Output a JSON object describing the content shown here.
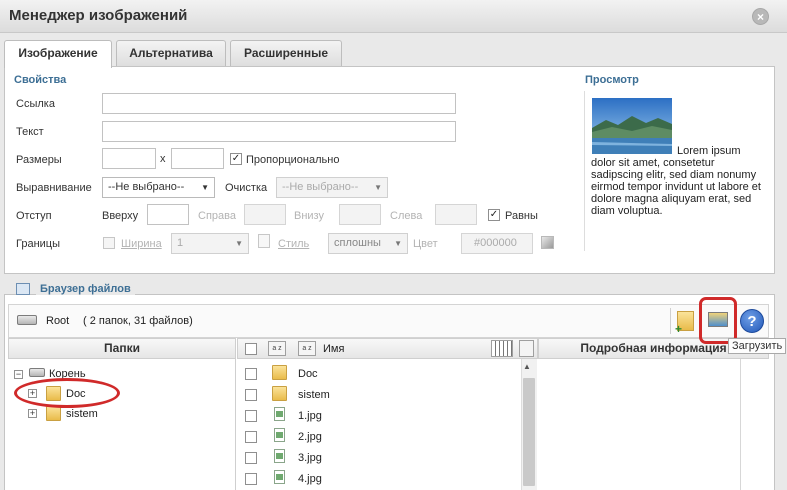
{
  "window": {
    "title": "Менеджер изображений",
    "close_glyph": "×"
  },
  "tabs": [
    {
      "label": "Изображение",
      "active": true
    },
    {
      "label": "Альтернатива",
      "active": false
    },
    {
      "label": "Расширенные",
      "active": false
    }
  ],
  "properties": {
    "section_title": "Свойства",
    "link_label": "Ссылка",
    "text_label": "Текст",
    "dimensions_label": "Размеры",
    "dimensions_separator": "x",
    "proportional_label": "Пропорционально",
    "proportional_checked": true,
    "align_label": "Выравнивание",
    "align_value": "--Не выбрано--",
    "clear_label": "Очистка",
    "clear_value": "--Не выбрано--",
    "margin_label": "Отступ",
    "margin_top_label": "Вверху",
    "margin_right_label": "Справа",
    "margin_bottom_label": "Внизу",
    "margin_left_label": "Слева",
    "equal_label": "Равны",
    "equal_checked": true,
    "border_label": "Границы",
    "border_width_label": "Ширина",
    "border_width_value": "1",
    "border_style_label": "Стиль",
    "border_style_value": "сплошны",
    "border_color_label": "Цвет",
    "border_color_value": "#000000"
  },
  "preview": {
    "section_title": "Просмотр",
    "text_first": "Lorem ipsum",
    "text_rest": "dolor sit amet, consetetur sadipscing elitr, sed diam nonumy eirmod tempor invidunt ut labore et dolore magna aliquyam erat, sed diam voluptua."
  },
  "file_browser": {
    "title": "Браузер файлов",
    "root_label": "Root",
    "root_info": "( 2 папок, 31 файлов)",
    "folders_header": "Папки",
    "name_header": "Имя",
    "details_header": "Подробная информация",
    "upload_tooltip": "Загрузить",
    "help_glyph": "?",
    "tree": {
      "root": "Корень",
      "children": [
        "Doc",
        "sistem"
      ]
    },
    "items": [
      {
        "name": "Doc",
        "kind": "folder"
      },
      {
        "name": "sistem",
        "kind": "folder"
      },
      {
        "name": "1.jpg",
        "kind": "file"
      },
      {
        "name": "2.jpg",
        "kind": "file"
      },
      {
        "name": "3.jpg",
        "kind": "file"
      },
      {
        "name": "4.jpg",
        "kind": "file"
      }
    ]
  },
  "colors": {
    "accent": "#3d6f95",
    "highlight": "#d02a2a"
  }
}
